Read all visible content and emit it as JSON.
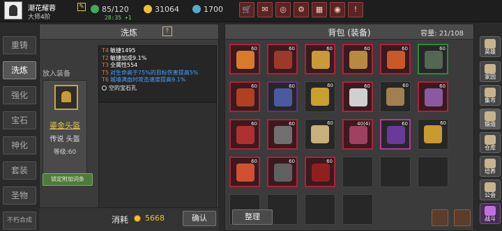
{
  "player": {
    "name": "潮花耀蓉",
    "rank": "大师4阶"
  },
  "resources": {
    "stamina": "85/120",
    "gold": "31064",
    "gems": "1700",
    "timer": "28:35 +1"
  },
  "top_buttons": [
    "shop",
    "mail",
    "controller",
    "settings",
    "gift",
    "wheel",
    "alert"
  ],
  "side_nav": [
    "重铸",
    "洗炼",
    "强化",
    "宝石",
    "神化",
    "套装",
    "圣物",
    "不朽合成"
  ],
  "left_panel": {
    "title": "洗炼",
    "put_equip_label": "放入装备",
    "equip": {
      "name": "鎏金头盔",
      "type": "传说 头盔",
      "level": "等级:60"
    },
    "lock_button": "锁定附加词条",
    "attributes": [
      {
        "tier": "T4",
        "text": "敏捷1495",
        "color": "#ffffff"
      },
      {
        "tier": "T2",
        "text": "敏捷加成9.1%",
        "color": "#ffffff"
      },
      {
        "tier": "T3",
        "text": "全属性554",
        "color": "#ffffff"
      },
      {
        "tier": "T5",
        "text": "对生命高于75%的目标伤害提高5%",
        "color": "#4aa0ff"
      },
      {
        "tier": "T6",
        "text": "城墙满血时攻击速度提高9.1%",
        "color": "#4aa0ff"
      }
    ],
    "gem_slot": "空的宝石孔",
    "cost_label": "消耗",
    "cost_value": "5668",
    "confirm": "确认"
  },
  "bag": {
    "title": "背包 (装备)",
    "capacity": "容量: 21/108",
    "tidy": "整理",
    "items": [
      {
        "lv": "60",
        "frame": "rare",
        "color": "#d87a2a"
      },
      {
        "lv": "60",
        "frame": "rare",
        "color": "#9b3a2a"
      },
      {
        "lv": "60",
        "frame": "rare",
        "color": "#c89a3a"
      },
      {
        "lv": "60",
        "frame": "rare",
        "color": "#b88a40"
      },
      {
        "lv": "60",
        "frame": "rare",
        "color": "#c85a2a"
      },
      {
        "lv": "60",
        "frame": "green",
        "color": "#556655"
      },
      {
        "lv": "60",
        "frame": "rare",
        "color": "#b04020"
      },
      {
        "lv": "60",
        "frame": "epic",
        "color": "#4a5aa0"
      },
      {
        "lv": "60",
        "frame": "normal",
        "color": "#c8a030"
      },
      {
        "lv": "60",
        "frame": "rare",
        "color": "#d0d0d0"
      },
      {
        "lv": "60",
        "frame": "normal",
        "color": "#a08050"
      },
      {
        "lv": "60",
        "frame": "rare",
        "color": "#8a5aa0"
      },
      {
        "lv": "60",
        "frame": "rare",
        "color": "#b03030"
      },
      {
        "lv": "60",
        "frame": "rare",
        "color": "#707070"
      },
      {
        "lv": "60",
        "frame": "normal",
        "color": "#c8b07a"
      },
      {
        "lv": "40(4)",
        "frame": "rare",
        "color": "#a04060"
      },
      {
        "lv": "60",
        "frame": "legend",
        "color": "#6a3a9a"
      },
      {
        "lv": "60",
        "frame": "normal",
        "color": "#c89a30"
      },
      {
        "lv": "60",
        "frame": "rare",
        "color": "#d05030"
      },
      {
        "lv": "60",
        "frame": "rare",
        "color": "#606060"
      },
      {
        "lv": "60",
        "frame": "rare",
        "color": "#902020"
      }
    ]
  },
  "right_nav": [
    "英雄",
    "家园",
    "集市",
    "锻造",
    "仓库",
    "培养",
    "公会",
    "战斗"
  ]
}
